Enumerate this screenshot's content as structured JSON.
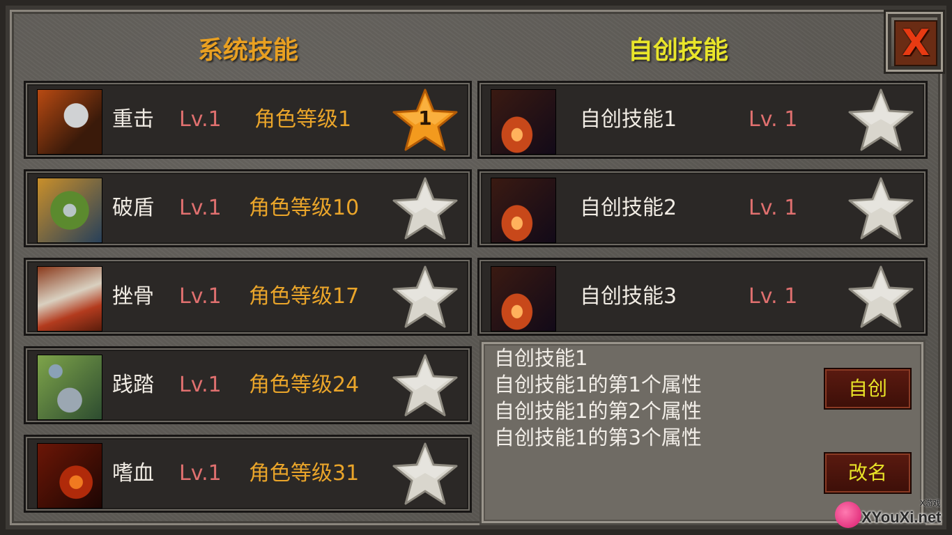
{
  "headers": {
    "system_skills": "系统技能",
    "custom_skills": "自创技能"
  },
  "close_button": {
    "label": "X",
    "icon": "close-icon",
    "color": "#e83a12"
  },
  "system_skills": [
    {
      "name": "重击",
      "level": "Lv.1",
      "requirement": "角色等级1",
      "icon": "heavy-strike-icon",
      "star_active": true,
      "star_number": "1"
    },
    {
      "name": "破盾",
      "level": "Lv.1",
      "requirement": "角色等级10",
      "icon": "shield-break-icon",
      "star_active": false
    },
    {
      "name": "挫骨",
      "level": "Lv.1",
      "requirement": "角色等级17",
      "icon": "bone-crush-icon",
      "star_active": false
    },
    {
      "name": "践踏",
      "level": "Lv.1",
      "requirement": "角色等级24",
      "icon": "stomp-icon",
      "star_active": false
    },
    {
      "name": "嗜血",
      "level": "Lv.1",
      "requirement": "角色等级31",
      "icon": "bloodthirst-icon",
      "star_active": false
    }
  ],
  "custom_skills": [
    {
      "name": "自创技能1",
      "level": "Lv. 1",
      "icon": "claw-slash-icon",
      "star_active": false
    },
    {
      "name": "自创技能2",
      "level": "Lv. 1",
      "icon": "claw-slash-icon",
      "star_active": false
    },
    {
      "name": "自创技能3",
      "level": "Lv. 1",
      "icon": "claw-slash-icon",
      "star_active": false
    }
  ],
  "description": {
    "lines": [
      "自创技能1",
      "自创技能1的第1个属性",
      "自创技能1的第2个属性",
      "自创技能1的第3个属性"
    ]
  },
  "buttons": {
    "create": "自创",
    "rename": "改名"
  },
  "watermark": {
    "text": "XYouXi.net",
    "small": "X游戏"
  },
  "colors": {
    "system_header": "#e9a021",
    "custom_header": "#e9e52a",
    "level_text": "#e0706f",
    "requirement_text": "#eaa52a",
    "active_star": "#f39a1e",
    "inactive_star": "#d9d6cd"
  }
}
